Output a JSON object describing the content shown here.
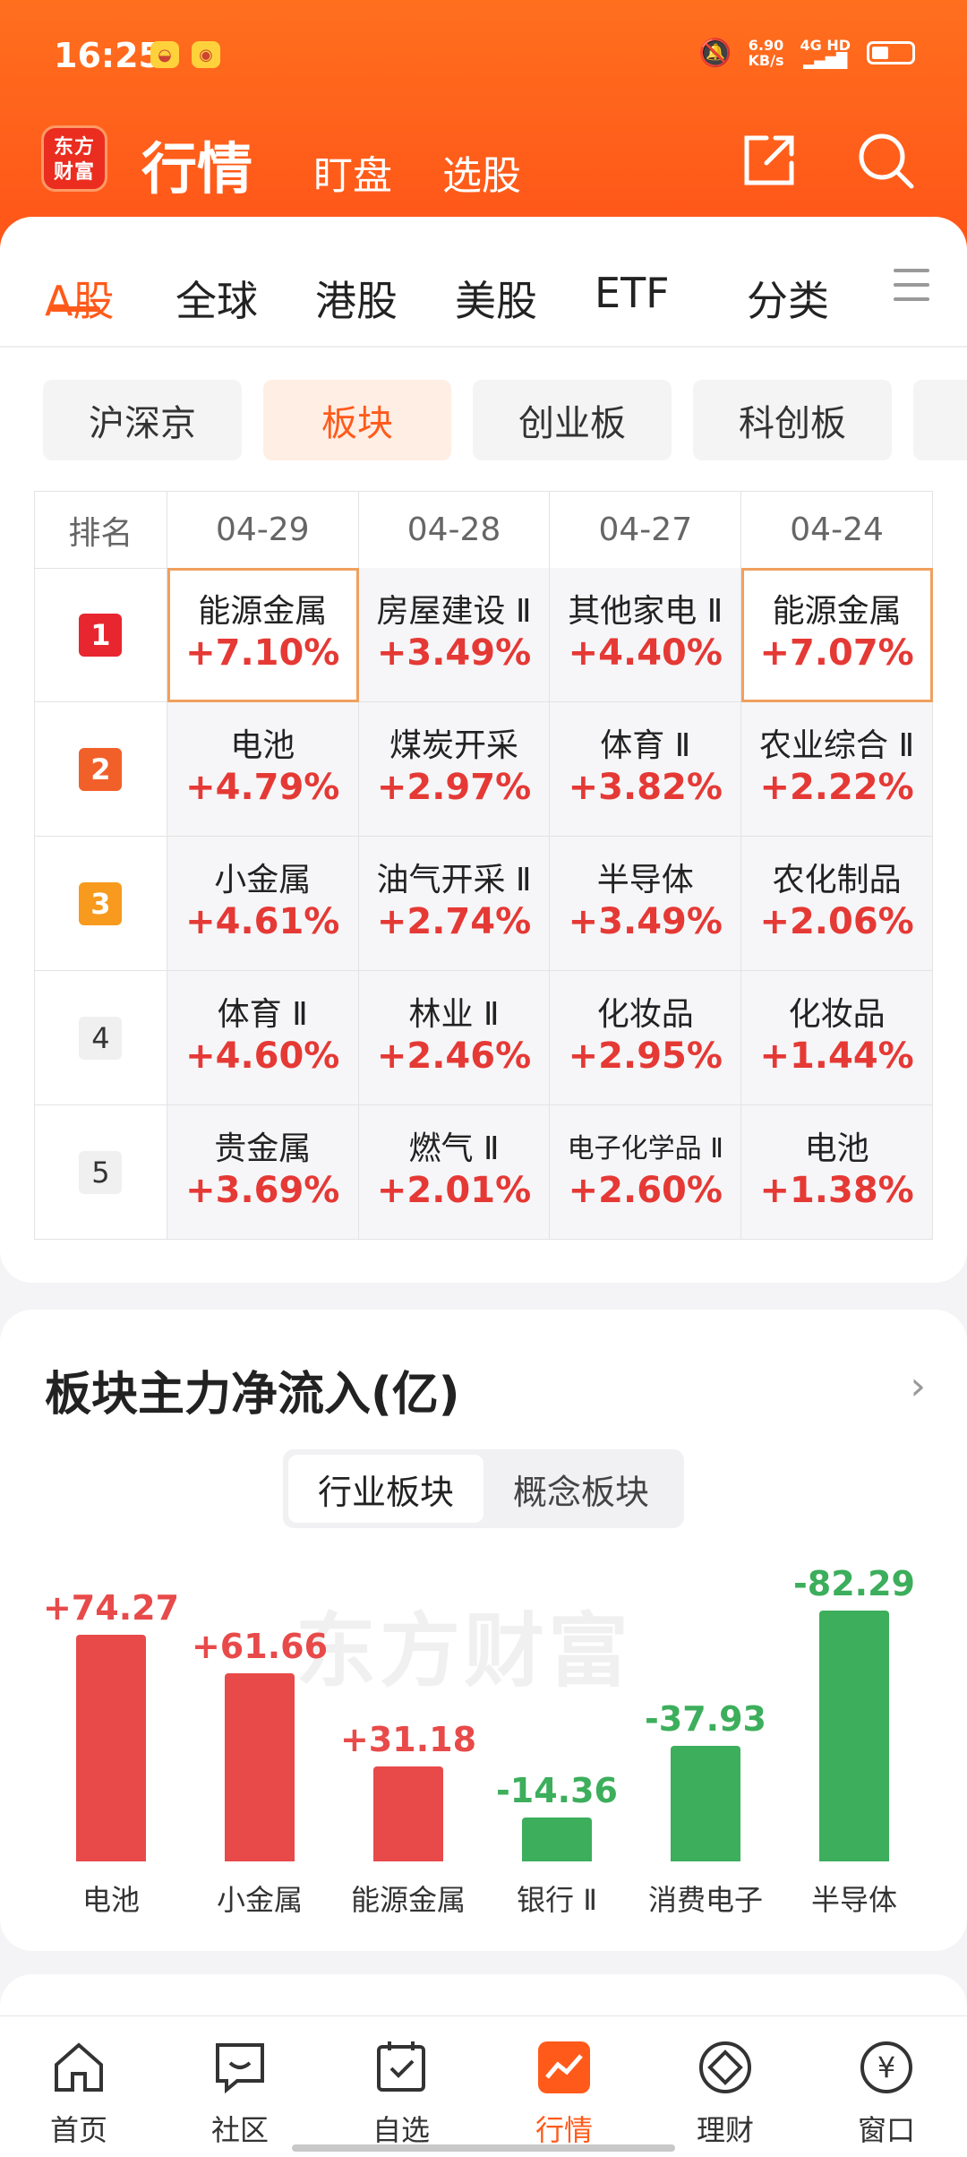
{
  "status": {
    "time": "16:25",
    "speed_top": "6.90",
    "speed_bottom": "KB/s",
    "net_top": "4G HD",
    "net_bottom": "▂▄▆█"
  },
  "app": {
    "logo_line1": "东方",
    "logo_line2": "财富",
    "title": "行情",
    "nav1": "盯盘",
    "nav2": "选股"
  },
  "tabs": [
    {
      "label": "A股"
    },
    {
      "label": "全球"
    },
    {
      "label": "港股"
    },
    {
      "label": "美股"
    },
    {
      "label": "ETF"
    },
    {
      "label": "分类"
    }
  ],
  "chips": [
    {
      "label": "沪深京"
    },
    {
      "label": "板块"
    },
    {
      "label": "创业板"
    },
    {
      "label": "科创板"
    }
  ],
  "ranking": {
    "header": [
      "排名",
      "04-29",
      "04-28",
      "04-27",
      "04-24"
    ],
    "rows": [
      {
        "rank": "1",
        "color": "#e8262f",
        "cells": [
          {
            "name": "能源金属",
            "pct": "+7.10%"
          },
          {
            "name": "房屋建设 Ⅱ",
            "pct": "+3.49%"
          },
          {
            "name": "其他家电 Ⅱ",
            "pct": "+4.40%"
          },
          {
            "name": "能源金属",
            "pct": "+7.07%"
          }
        ]
      },
      {
        "rank": "2",
        "color": "#f2602a",
        "cells": [
          {
            "name": "电池",
            "pct": "+4.79%"
          },
          {
            "name": "煤炭开采",
            "pct": "+2.97%"
          },
          {
            "name": "体育 Ⅱ",
            "pct": "+3.82%"
          },
          {
            "name": "农业综合 Ⅱ",
            "pct": "+2.22%"
          }
        ]
      },
      {
        "rank": "3",
        "color": "#f79a1e",
        "cells": [
          {
            "name": "小金属",
            "pct": "+4.61%"
          },
          {
            "name": "油气开采 Ⅱ",
            "pct": "+2.74%"
          },
          {
            "name": "半导体",
            "pct": "+3.49%"
          },
          {
            "name": "农化制品",
            "pct": "+2.06%"
          }
        ]
      },
      {
        "rank": "4",
        "color": "",
        "cells": [
          {
            "name": "体育 Ⅱ",
            "pct": "+4.60%"
          },
          {
            "name": "林业 Ⅱ",
            "pct": "+2.46%"
          },
          {
            "name": "化妆品",
            "pct": "+2.95%"
          },
          {
            "name": "化妆品",
            "pct": "+1.44%"
          }
        ]
      },
      {
        "rank": "5",
        "color": "",
        "cells": [
          {
            "name": "贵金属",
            "pct": "+3.69%"
          },
          {
            "name": "燃气 Ⅱ",
            "pct": "+2.01%"
          },
          {
            "name": "电子化学品 Ⅱ",
            "pct": "+2.60%"
          },
          {
            "name": "电池",
            "pct": "+1.38%"
          }
        ]
      }
    ]
  },
  "flow": {
    "title": "板块主力净流入(亿)",
    "seg": [
      "行业板块",
      "概念板块"
    ],
    "watermark": "东方财富"
  },
  "chart_data": {
    "type": "bar",
    "categories": [
      "电池",
      "小金属",
      "能源金属",
      "银行 Ⅱ",
      "消费电子",
      "半导体"
    ],
    "values": [
      74.27,
      61.66,
      31.18,
      -14.36,
      -37.93,
      -82.29
    ],
    "labels": [
      "+74.27",
      "+61.66",
      "+31.18",
      "-14.36",
      "-37.93",
      "-82.29"
    ],
    "colors": {
      "positive": "#e84a4a",
      "negative": "#3cae5c"
    }
  },
  "bottom_nav": [
    {
      "label": "首页"
    },
    {
      "label": "社区"
    },
    {
      "label": "自选"
    },
    {
      "label": "行情"
    },
    {
      "label": "理财"
    },
    {
      "label": "窗口"
    }
  ],
  "bottom_nav_money_glyph": "¥",
  "colors": {
    "brand": "#ff5a1a",
    "up": "#e53935",
    "down": "#3cae5c"
  }
}
